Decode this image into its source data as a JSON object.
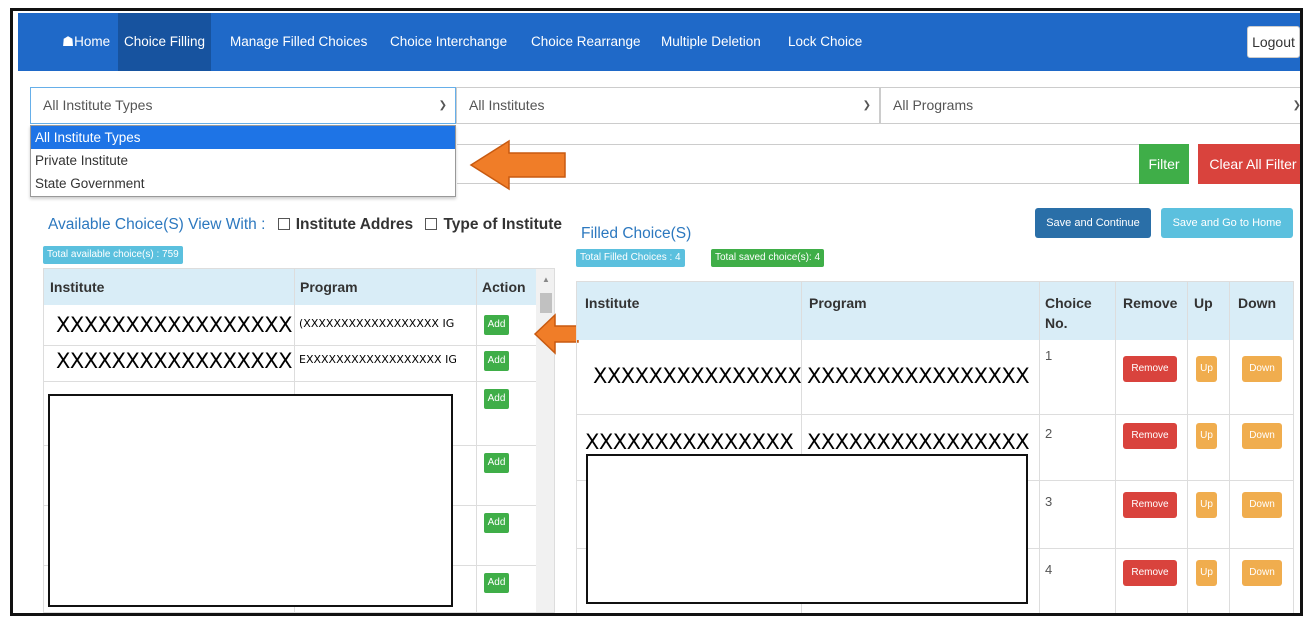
{
  "nav": {
    "home": "Home",
    "items": [
      "Choice Filling",
      "Manage Filled Choices",
      "Choice Interchange",
      "Choice Rearrange",
      "Multiple Deletion",
      "Lock Choice"
    ],
    "logout": "Logout",
    "active": "Choice Filling"
  },
  "filters": {
    "institute_type": "All Institute Types",
    "institutes": "All Institutes",
    "programs": "All Programs",
    "institute_type_options": [
      "All Institute Types",
      "Private Institute",
      "State Government"
    ],
    "filter_btn": "Filter",
    "clear_btn": "Clear All Filter"
  },
  "available": {
    "heading": "Available Choice(S) View With :",
    "opt_address": "Institute Addres",
    "opt_type": "Type of Institute",
    "total_badge": "Total available choice(s) : 759",
    "columns": [
      "Institute",
      "Program",
      "Action"
    ],
    "rows": [
      {
        "institute": "XXXXXXXXXXXXXXXXX",
        "program": "XXXXXXXXXXXXXXXXXX",
        "program_prefix": "(",
        "program_suffix": "IG",
        "action": "Add"
      },
      {
        "institute": "XXXXXXXXXXXXXXXXX",
        "program": "XXXXXXXXXXXXXXXXXX",
        "program_prefix": "E",
        "program_suffix": "IG",
        "action": "Add"
      },
      {
        "action": "Add"
      },
      {
        "action": "Add"
      },
      {
        "action": "Add"
      },
      {
        "action": "Add"
      }
    ]
  },
  "filled": {
    "heading": "Filled Choice(S)",
    "save_continue": "Save and Continue",
    "save_home": "Save and Go to Home",
    "total_filled": "Total Filled Choices : 4",
    "total_saved": "Total saved choice(s): 4",
    "columns": [
      "Institute",
      "Program",
      "Choice No.",
      "Remove",
      "Up",
      "Down"
    ],
    "rows": [
      {
        "institute": "XXXXXXXXXXXXXXX",
        "program": "XXXXXXXXXXXXXXXX",
        "choice_no": "1",
        "remove": "Remove",
        "up": "Up",
        "down": "Down"
      },
      {
        "institute": "XXXXXXXXXXXXXXX",
        "program": "XXXXXXXXXXXXXXXX",
        "choice_no": "2",
        "remove": "Remove",
        "up": "Up",
        "down": "Down"
      },
      {
        "choice_no": "3",
        "remove": "Remove",
        "up": "Up",
        "down": "Down"
      },
      {
        "choice_no": "4",
        "remove": "Remove",
        "up": "Up",
        "down": "Down"
      }
    ]
  },
  "colors": {
    "navbar": "#1f69c8",
    "success": "#3fae48",
    "danger": "#d9433d",
    "warning": "#f0ad4e",
    "info": "#5bc0de",
    "arrow": "#f07d28"
  }
}
